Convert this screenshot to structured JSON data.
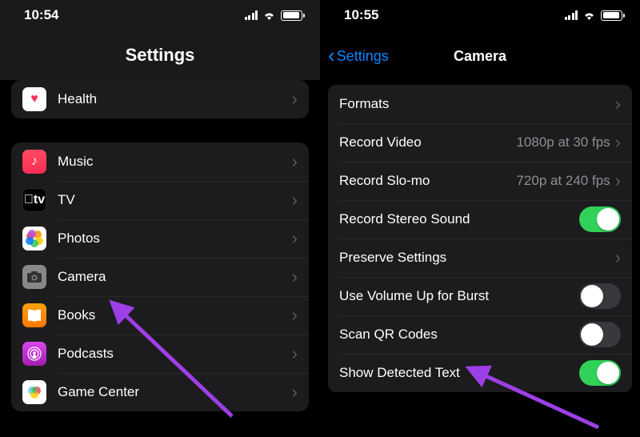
{
  "left": {
    "time": "10:54",
    "title": "Settings",
    "group1": [
      {
        "icon": "health-icon",
        "label": "Health"
      }
    ],
    "group2": [
      {
        "icon": "music-icon",
        "label": "Music"
      },
      {
        "icon": "tv-icon",
        "label": "TV"
      },
      {
        "icon": "photos-icon",
        "label": "Photos"
      },
      {
        "icon": "camera-icon",
        "label": "Camera"
      },
      {
        "icon": "books-icon",
        "label": "Books"
      },
      {
        "icon": "podcasts-icon",
        "label": "Podcasts"
      },
      {
        "icon": "gamecenter-icon",
        "label": "Game Center"
      }
    ]
  },
  "right": {
    "time": "10:55",
    "back": "Settings",
    "title": "Camera",
    "rows": {
      "formats": {
        "label": "Formats"
      },
      "record_video": {
        "label": "Record Video",
        "value": "1080p at 30 fps"
      },
      "record_slomo": {
        "label": "Record Slo-mo",
        "value": "720p at 240 fps"
      },
      "stereo": {
        "label": "Record Stereo Sound",
        "on": true
      },
      "preserve": {
        "label": "Preserve Settings"
      },
      "volume_burst": {
        "label": "Use Volume Up for Burst",
        "on": false
      },
      "scan_qr": {
        "label": "Scan QR Codes",
        "on": false
      },
      "show_text": {
        "label": "Show Detected Text",
        "on": true
      }
    }
  },
  "accent_green": "#30d158",
  "accent_blue": "#0a84ff",
  "accent_purple": "#9d3fe7"
}
